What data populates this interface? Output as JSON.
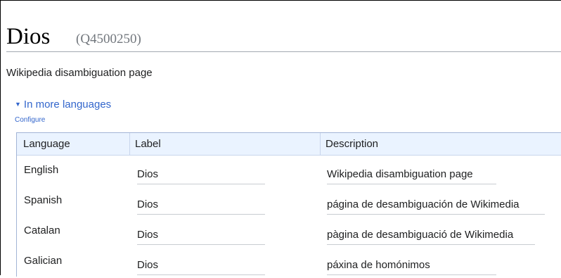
{
  "header": {
    "title": "Dios",
    "qid": "(Q4500250)"
  },
  "description": "Wikipedia disambiguation page",
  "languages_toggle": {
    "label": "In more languages"
  },
  "configure_label": "Configure",
  "table": {
    "headers": {
      "language": "Language",
      "label": "Label",
      "description": "Description"
    },
    "rows": [
      {
        "language": "English",
        "label": "Dios",
        "description": "Wikipedia disambiguation page"
      },
      {
        "language": "Spanish",
        "label": "Dios",
        "description": "página de desambiguación de Wikimedia"
      },
      {
        "language": "Catalan",
        "label": "Dios",
        "description": "pàgina de desambiguació de Wikimedia"
      },
      {
        "language": "Galician",
        "label": "Dios",
        "description": "páxina de homónimos"
      }
    ]
  }
}
